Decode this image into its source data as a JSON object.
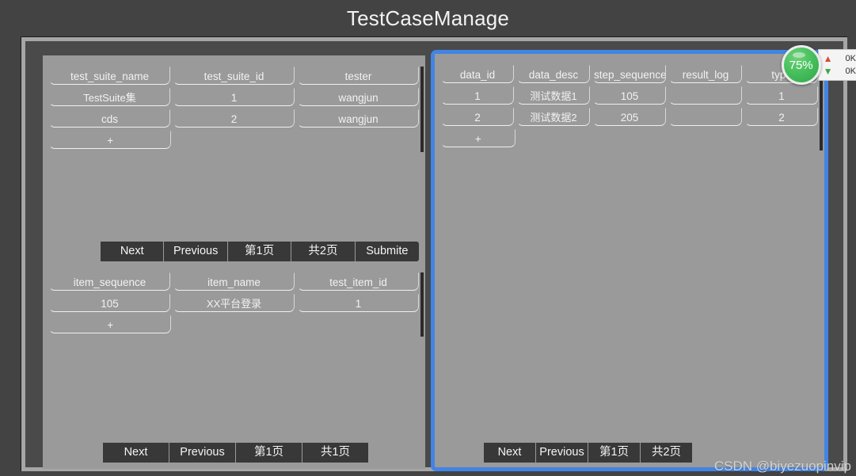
{
  "window": {
    "title": "TestCaseManage"
  },
  "net_widget": {
    "percent": "75%",
    "up_icon": "arrow-up-icon",
    "up_value": "0K",
    "down_icon": "arrow-down-icon",
    "down_value": "0K"
  },
  "watermark": {
    "text": "CSDN @biyezuopinvip"
  },
  "colors": {
    "selection_blue": "#4184e4",
    "panel_gray": "#9a9a9a",
    "button_dark": "#383838",
    "window_dark": "#434343",
    "frame_light": "#a6a6a6",
    "net_green": "#46bf5c",
    "arrow_up_red": "#d94c33",
    "arrow_down_green": "#3ca544"
  },
  "panels": {
    "test_suite": {
      "name": "test-suite-panel",
      "selected": false,
      "columns": [
        "test_suite_name",
        "test_suite_id",
        "tester"
      ],
      "rows": [
        [
          "TestSuite集",
          "1",
          "wangjun"
        ],
        [
          "cds",
          "2",
          "wangjun"
        ]
      ],
      "add_row_label": "+",
      "toolbar": {
        "buttons": [
          "Next",
          "Previous",
          "第1页",
          "共2页",
          "Submite"
        ]
      }
    },
    "test_item": {
      "name": "test-item-panel",
      "selected": false,
      "columns": [
        "item_sequence",
        "item_name",
        "test_item_id"
      ],
      "rows": [
        [
          "105",
          "XX平台登录",
          "1"
        ]
      ],
      "add_row_label": "+",
      "toolbar": {
        "buttons": [
          "Next",
          "Previous",
          "第1页",
          "共1页"
        ]
      }
    },
    "test_data": {
      "name": "test-data-panel",
      "selected": true,
      "columns": [
        "data_id",
        "data_desc",
        "step_sequence",
        "result_log",
        "type"
      ],
      "rows": [
        [
          "1",
          "测试数据1",
          "105",
          "",
          "1"
        ],
        [
          "2",
          "测试数据2",
          "205",
          "",
          "2"
        ]
      ],
      "add_row_label": "+",
      "toolbar": {
        "buttons": [
          "Next",
          "Previous",
          "第1页",
          "共2页"
        ]
      }
    }
  }
}
